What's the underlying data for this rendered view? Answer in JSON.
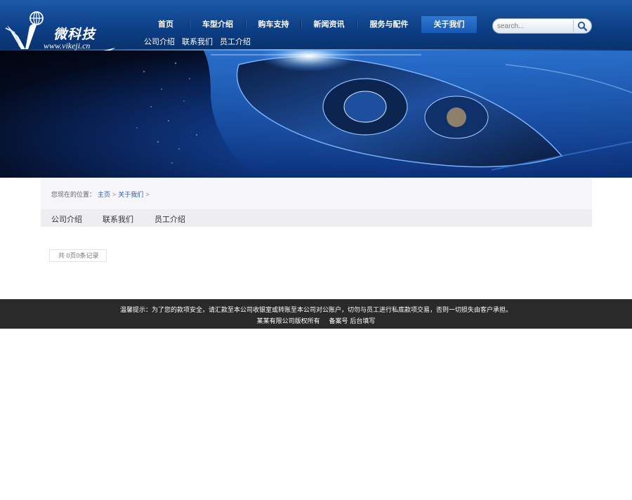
{
  "site": {
    "logo_cn": "微科技",
    "logo_url": "www.vikeji.cn"
  },
  "nav": {
    "items": [
      {
        "label": "首页",
        "active": false
      },
      {
        "label": "车型介绍",
        "active": false
      },
      {
        "label": "购车支持",
        "active": false
      },
      {
        "label": "新闻资讯",
        "active": false
      },
      {
        "label": "服务与配件",
        "active": false
      },
      {
        "label": "关于我们",
        "active": true
      }
    ],
    "sub_items": [
      "公司介绍",
      "联系我们",
      "员工介绍"
    ]
  },
  "search": {
    "placeholder": "search...",
    "icon": "search-icon"
  },
  "breadcrumb": {
    "prefix": "您现在的位置：",
    "items": [
      "主页",
      "关于我们"
    ],
    "separator": ">"
  },
  "tabs": [
    "公司介绍",
    "联系我们",
    "员工介绍"
  ],
  "pager": {
    "text": "共 0页0条记录"
  },
  "footer": {
    "notice": "温馨提示：为了您的款项安全，请汇款至本公司收银室或转账至本公司对公账户，切勿与员工进行私底款项交易，否则一切损失由客户承担。",
    "copyright": "某某有限公司版权所有",
    "icp": "备案号 后台填写"
  },
  "colors": {
    "header_blue": "#0d3f86",
    "nav_active": "#1659b5",
    "link_blue": "#2a5aa8",
    "footer_bg": "#2a2a2a"
  }
}
